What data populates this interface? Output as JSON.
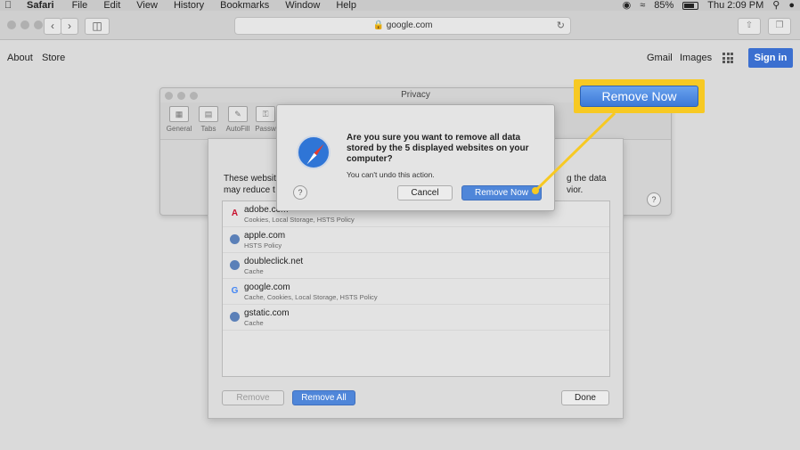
{
  "menubar": {
    "app": "Safari",
    "menus": [
      "File",
      "Edit",
      "View",
      "History",
      "Bookmarks",
      "Window",
      "Help"
    ],
    "battery": "85%",
    "clock": "Thu 2:09 PM"
  },
  "toolbar": {
    "url": "google.com"
  },
  "google": {
    "about": "About",
    "store": "Store",
    "gmail": "Gmail",
    "images": "Images",
    "signin": "Sign in"
  },
  "prefs": {
    "title": "Privacy",
    "tabs": [
      "General",
      "Tabs",
      "AutoFill",
      "Passw"
    ],
    "search_placeholder": "arch"
  },
  "sheet": {
    "desc_line1": "These websit",
    "desc_line2": "may reduce t",
    "desc_right1": "g the data",
    "desc_right2": "vior.",
    "sites": [
      {
        "domain": "adobe.com",
        "meta": "Cookies, Local Storage, HSTS Policy",
        "icon": "adobe-icon"
      },
      {
        "domain": "apple.com",
        "meta": "HSTS Policy",
        "icon": "globe-icon"
      },
      {
        "domain": "doubleclick.net",
        "meta": "Cache",
        "icon": "globe-icon"
      },
      {
        "domain": "google.com",
        "meta": "Cache, Cookies, Local Storage, HSTS Policy",
        "icon": "google-icon"
      },
      {
        "domain": "gstatic.com",
        "meta": "Cache",
        "icon": "globe-icon"
      }
    ],
    "remove": "Remove",
    "remove_all": "Remove All",
    "done": "Done"
  },
  "alert": {
    "message": "Are you sure you want to remove all data stored by the 5 displayed websites on your computer?",
    "sub": "You can't undo this action.",
    "cancel": "Cancel",
    "remove_now": "Remove Now"
  },
  "callout": {
    "label": "Remove Now",
    "color": "#f7c923"
  }
}
